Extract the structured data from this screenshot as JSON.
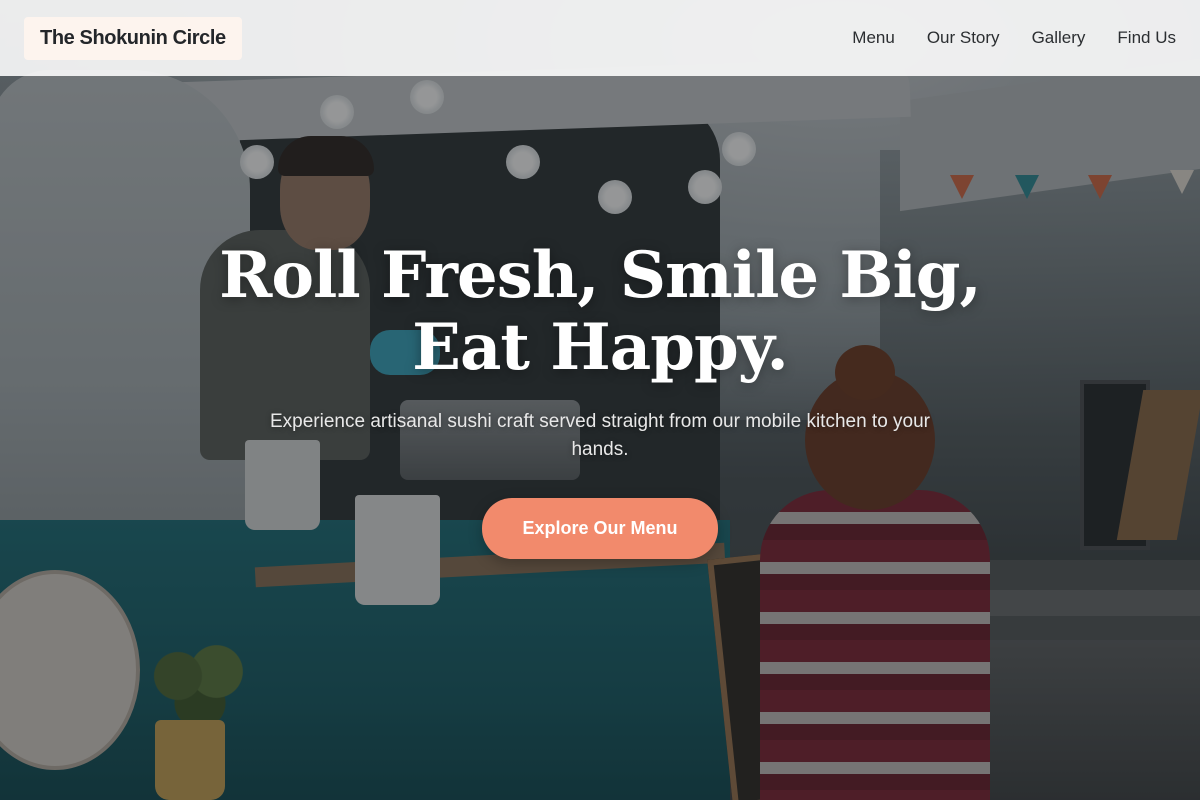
{
  "header": {
    "brand": "The Shokunin Circle",
    "nav": [
      {
        "label": "Menu"
      },
      {
        "label": "Our Story"
      },
      {
        "label": "Gallery"
      },
      {
        "label": "Find Us"
      }
    ]
  },
  "hero": {
    "title_line1": "Roll Fresh, Smile Big,",
    "title_line2": "Eat Happy.",
    "subtitle": "Experience artisanal sushi craft served straight from our mobile kitchen to your hands.",
    "cta_label": "Explore Our Menu"
  },
  "colors": {
    "accent": "#f28a6c",
    "header_bg": "#ffffff",
    "brand_bg": "#fdf4ee",
    "text_dark": "#23262a"
  }
}
